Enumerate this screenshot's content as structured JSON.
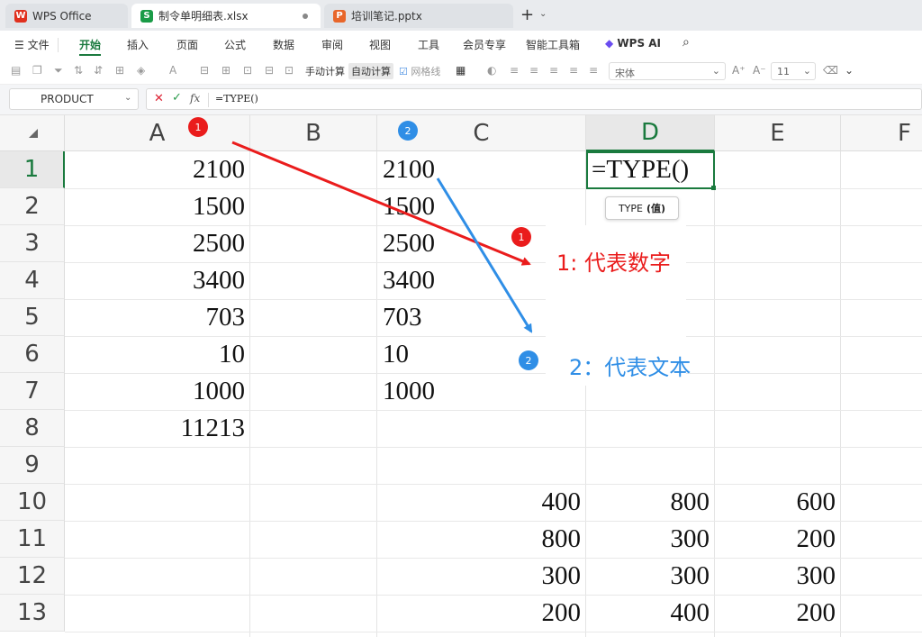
{
  "tabs": [
    {
      "label": "WPS Office",
      "icon": "wps-logo-icon",
      "color": "#e0301e"
    },
    {
      "label": "制令单明细表.xlsx",
      "icon": "spreadsheet-s-icon",
      "color": "#1a9b47"
    },
    {
      "label": "培训笔记.pptx",
      "icon": "presentation-p-icon",
      "color": "#e8662a"
    }
  ],
  "menu": {
    "file": "文件",
    "items": [
      "开始",
      "插入",
      "页面",
      "公式",
      "数据",
      "审阅",
      "视图",
      "工具",
      "会员专享",
      "智能工具箱"
    ],
    "ai": "WPS AI"
  },
  "toolbar": {
    "manual_calc": "手动计算",
    "auto_calc": "自动计算",
    "gridlines": "网格线",
    "font_name": "宋体",
    "font_size": "11"
  },
  "formula_bar": {
    "name_box": "PRODUCT",
    "fx": "fx",
    "content": "=TYPE()"
  },
  "grid": {
    "columns": [
      "A",
      "B",
      "C",
      "D",
      "E",
      "F"
    ],
    "rows": [
      "1",
      "2",
      "3",
      "4",
      "5",
      "6",
      "7",
      "8",
      "9",
      "10",
      "11",
      "12",
      "13"
    ],
    "col_a": [
      "2100",
      "1500",
      "2500",
      "3400",
      "703",
      "10",
      "1000",
      "11213"
    ],
    "col_c": [
      "2100",
      "1500",
      "2500",
      "3400",
      "703",
      "10",
      "1000"
    ],
    "lower_block": [
      [
        "400",
        "800",
        "600"
      ],
      [
        "800",
        "300",
        "200"
      ],
      [
        "300",
        "300",
        "300"
      ],
      [
        "200",
        "400",
        "200"
      ]
    ],
    "active_cell": "=TYPE()",
    "tooltip_fn": "TYPE",
    "tooltip_arg": "(值)"
  },
  "annotations": {
    "badge1": "1",
    "badge2": "2",
    "label1": "1: 代表数字",
    "label2": "2：代表文本",
    "red": "#ea1c1c",
    "blue": "#2f8ee6"
  }
}
